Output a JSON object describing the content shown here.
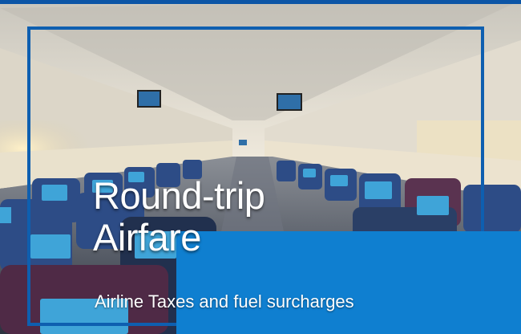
{
  "slide": {
    "title_line1": "Round-trip",
    "title_line2": "Airfare",
    "subtitle": "Airline Taxes and fuel surcharges"
  },
  "colors": {
    "accent_blue": "#0f7fd0",
    "frame_blue": "#0e5fb0",
    "top_bar_blue": "#0b55a6"
  },
  "background_image": "airplane-cabin-interior"
}
